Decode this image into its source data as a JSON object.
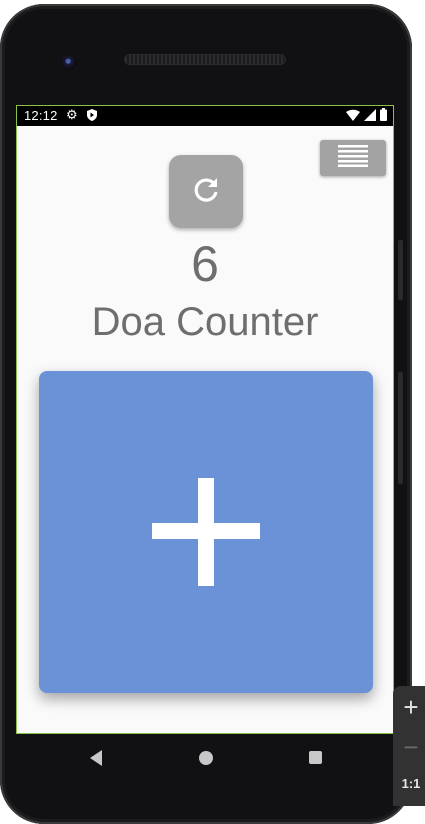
{
  "status_bar": {
    "time": "12:12",
    "icons": [
      "gear-icon",
      "shield-icon",
      "wifi-icon",
      "signal-icon",
      "battery-icon"
    ]
  },
  "app": {
    "title": "Doa Counter",
    "count": "6",
    "colors": {
      "plus_button": "#6b92d7",
      "reset_button": "#a4a4a4",
      "menu_button": "#a3a3a3",
      "text": "#6e6e6e",
      "background": "#fafafa"
    },
    "icons": {
      "reset": "refresh-icon",
      "menu": "menu-lines-icon",
      "increment": "plus-icon"
    }
  },
  "nav_bar": {
    "icons": [
      "back-icon",
      "home-icon",
      "recents-icon"
    ]
  },
  "emulator_toolbar": {
    "zoom_in": "+",
    "zoom_out": "−",
    "zoom_reset": "1:1"
  }
}
